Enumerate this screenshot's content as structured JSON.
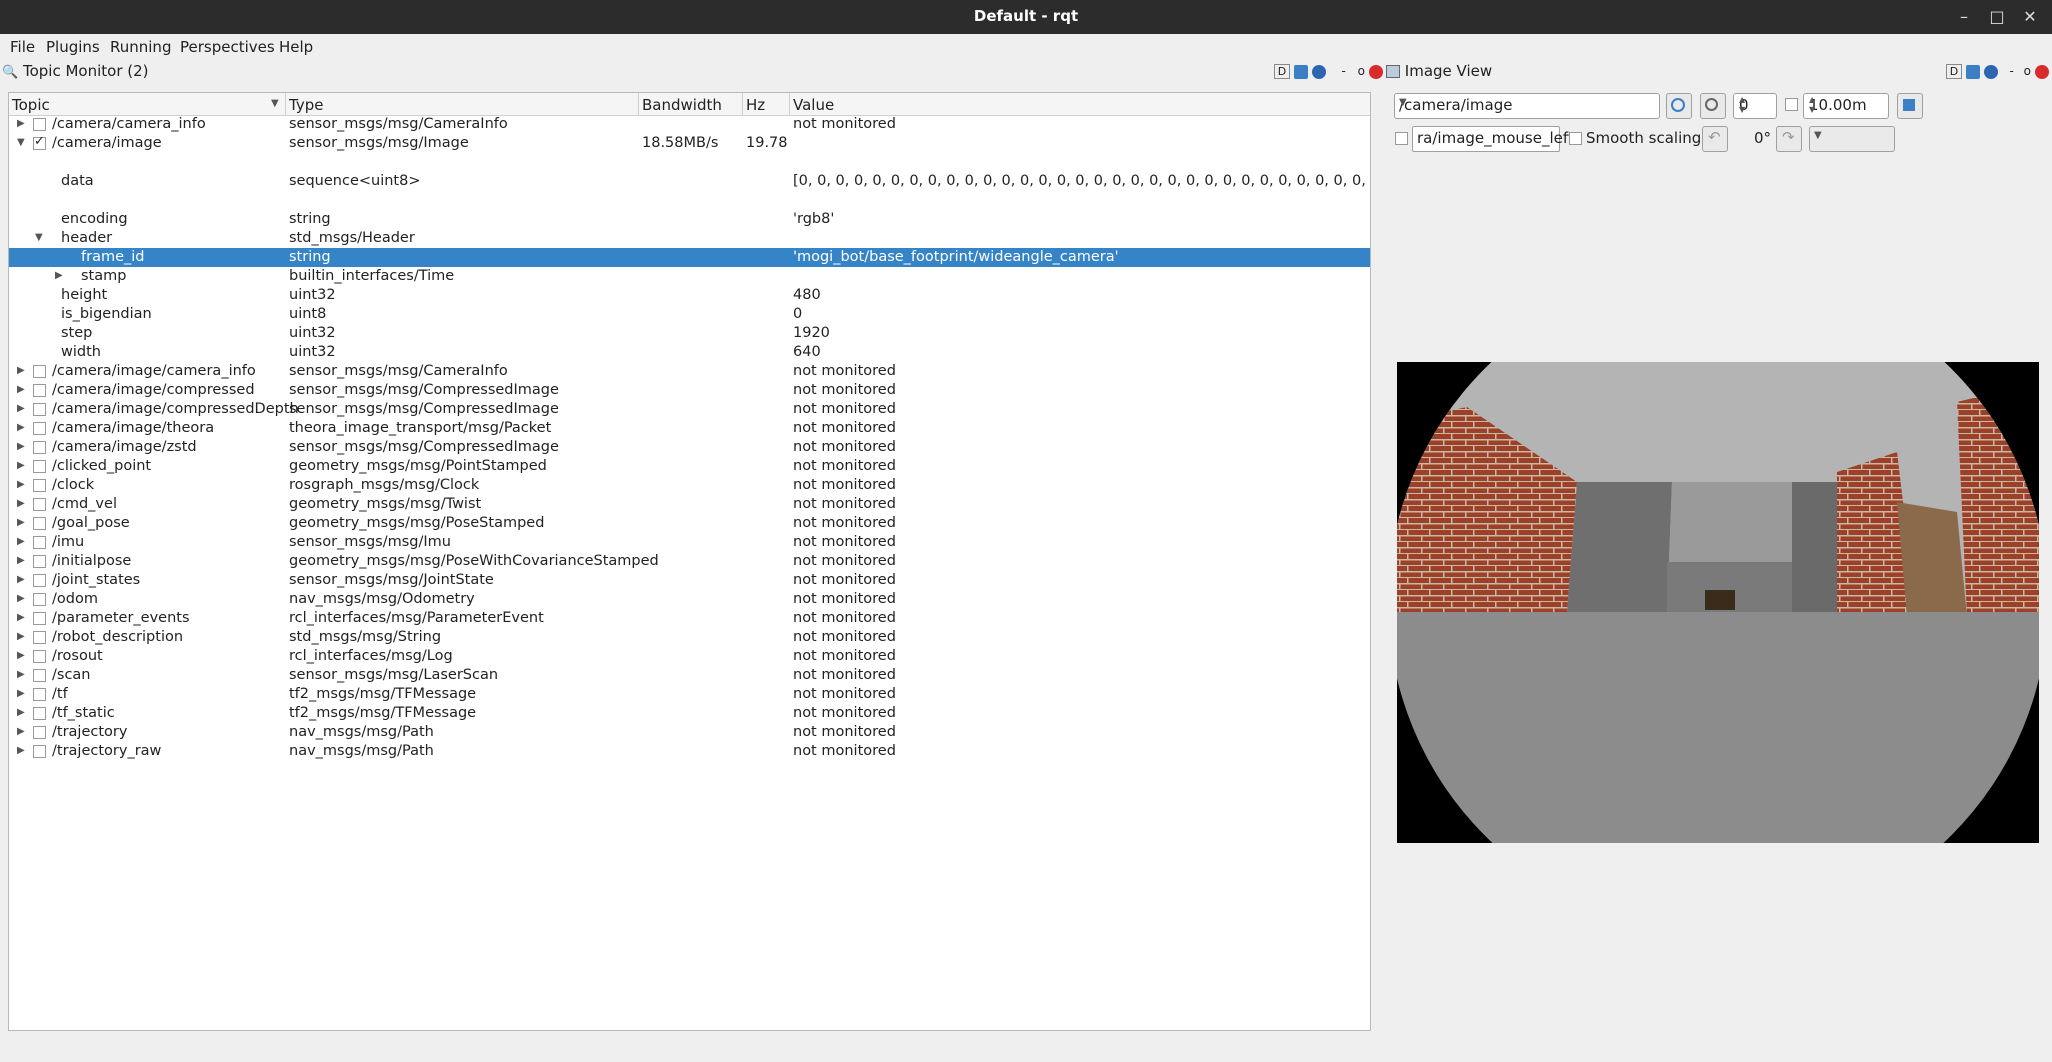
{
  "window": {
    "title": "Default - rqt"
  },
  "menu": [
    "File",
    "Plugins",
    "Running",
    "Perspectives",
    "Help"
  ],
  "topic_monitor": {
    "title": "Topic Monitor (2)",
    "columns": [
      "Topic",
      "Type",
      "Bandwidth",
      "Hz",
      "Value"
    ],
    "rows": [
      {
        "topic": "/camera/camera_info",
        "type": "sensor_msgs/msg/CameraInfo",
        "bw": "",
        "hz": "",
        "value": "not monitored"
      },
      {
        "topic": "/camera/image",
        "type": "sensor_msgs/msg/Image",
        "bw": "18.58MB/s",
        "hz": "19.78",
        "value": ""
      },
      {
        "topic": "data",
        "type": "sequence<uint8>",
        "bw": "",
        "hz": "",
        "value": "[0, 0, 0, 0, 0, 0, 0, 0, 0, 0, 0, 0, 0, 0, 0, 0, 0, 0, 0, 0, 0, 0, 0, 0, 0, 0, 0, 0, 0, 0, 0, 0, 0, 0, 0, 0, 0, ..."
      },
      {
        "topic": "encoding",
        "type": "string",
        "bw": "",
        "hz": "",
        "value": "'rgb8'"
      },
      {
        "topic": "header",
        "type": "std_msgs/Header",
        "bw": "",
        "hz": "",
        "value": ""
      },
      {
        "topic": "frame_id",
        "type": "string",
        "bw": "",
        "hz": "",
        "value": "'mogi_bot/base_footprint/wideangle_camera'"
      },
      {
        "topic": "stamp",
        "type": "builtin_interfaces/Time",
        "bw": "",
        "hz": "",
        "value": ""
      },
      {
        "topic": "height",
        "type": "uint32",
        "bw": "",
        "hz": "",
        "value": "480"
      },
      {
        "topic": "is_bigendian",
        "type": "uint8",
        "bw": "",
        "hz": "",
        "value": "0"
      },
      {
        "topic": "step",
        "type": "uint32",
        "bw": "",
        "hz": "",
        "value": "1920"
      },
      {
        "topic": "width",
        "type": "uint32",
        "bw": "",
        "hz": "",
        "value": "640"
      },
      {
        "topic": "/camera/image/camera_info",
        "type": "sensor_msgs/msg/CameraInfo",
        "bw": "",
        "hz": "",
        "value": "not monitored"
      },
      {
        "topic": "/camera/image/compressed",
        "type": "sensor_msgs/msg/CompressedImage",
        "bw": "",
        "hz": "",
        "value": "not monitored"
      },
      {
        "topic": "/camera/image/compressedDepth",
        "type": "sensor_msgs/msg/CompressedImage",
        "bw": "",
        "hz": "",
        "value": "not monitored"
      },
      {
        "topic": "/camera/image/theora",
        "type": "theora_image_transport/msg/Packet",
        "bw": "",
        "hz": "",
        "value": "not monitored"
      },
      {
        "topic": "/camera/image/zstd",
        "type": "sensor_msgs/msg/CompressedImage",
        "bw": "",
        "hz": "",
        "value": "not monitored"
      },
      {
        "topic": "/clicked_point",
        "type": "geometry_msgs/msg/PointStamped",
        "bw": "",
        "hz": "",
        "value": "not monitored"
      },
      {
        "topic": "/clock",
        "type": "rosgraph_msgs/msg/Clock",
        "bw": "",
        "hz": "",
        "value": "not monitored"
      },
      {
        "topic": "/cmd_vel",
        "type": "geometry_msgs/msg/Twist",
        "bw": "",
        "hz": "",
        "value": "not monitored"
      },
      {
        "topic": "/goal_pose",
        "type": "geometry_msgs/msg/PoseStamped",
        "bw": "",
        "hz": "",
        "value": "not monitored"
      },
      {
        "topic": "/imu",
        "type": "sensor_msgs/msg/Imu",
        "bw": "",
        "hz": "",
        "value": "not monitored"
      },
      {
        "topic": "/initialpose",
        "type": "geometry_msgs/msg/PoseWithCovarianceStamped",
        "bw": "",
        "hz": "",
        "value": "not monitored"
      },
      {
        "topic": "/joint_states",
        "type": "sensor_msgs/msg/JointState",
        "bw": "",
        "hz": "",
        "value": "not monitored"
      },
      {
        "topic": "/odom",
        "type": "nav_msgs/msg/Odometry",
        "bw": "",
        "hz": "",
        "value": "not monitored"
      },
      {
        "topic": "/parameter_events",
        "type": "rcl_interfaces/msg/ParameterEvent",
        "bw": "",
        "hz": "",
        "value": "not monitored"
      },
      {
        "topic": "/robot_description",
        "type": "std_msgs/msg/String",
        "bw": "",
        "hz": "",
        "value": "not monitored"
      },
      {
        "topic": "/rosout",
        "type": "rcl_interfaces/msg/Log",
        "bw": "",
        "hz": "",
        "value": "not monitored"
      },
      {
        "topic": "/scan",
        "type": "sensor_msgs/msg/LaserScan",
        "bw": "",
        "hz": "",
        "value": "not monitored"
      },
      {
        "topic": "/tf",
        "type": "tf2_msgs/msg/TFMessage",
        "bw": "",
        "hz": "",
        "value": "not monitored"
      },
      {
        "topic": "/tf_static",
        "type": "tf2_msgs/msg/TFMessage",
        "bw": "",
        "hz": "",
        "value": "not monitored"
      },
      {
        "topic": "/trajectory",
        "type": "nav_msgs/msg/Path",
        "bw": "",
        "hz": "",
        "value": "not monitored"
      },
      {
        "topic": "/trajectory_raw",
        "type": "nav_msgs/msg/Path",
        "bw": "",
        "hz": "",
        "value": "not monitored"
      }
    ]
  },
  "image_view": {
    "title": "Image View",
    "topic": "/camera/image",
    "spin_value": "0",
    "max_value": "10.00m",
    "mouse_topic": "ra/image_mouse_left",
    "smooth_label": "Smooth scaling",
    "rotation": "0°"
  },
  "dock_button_letter": "D",
  "colors": {
    "selection": "#3584c8",
    "titlebar": "#2c2c2c"
  }
}
